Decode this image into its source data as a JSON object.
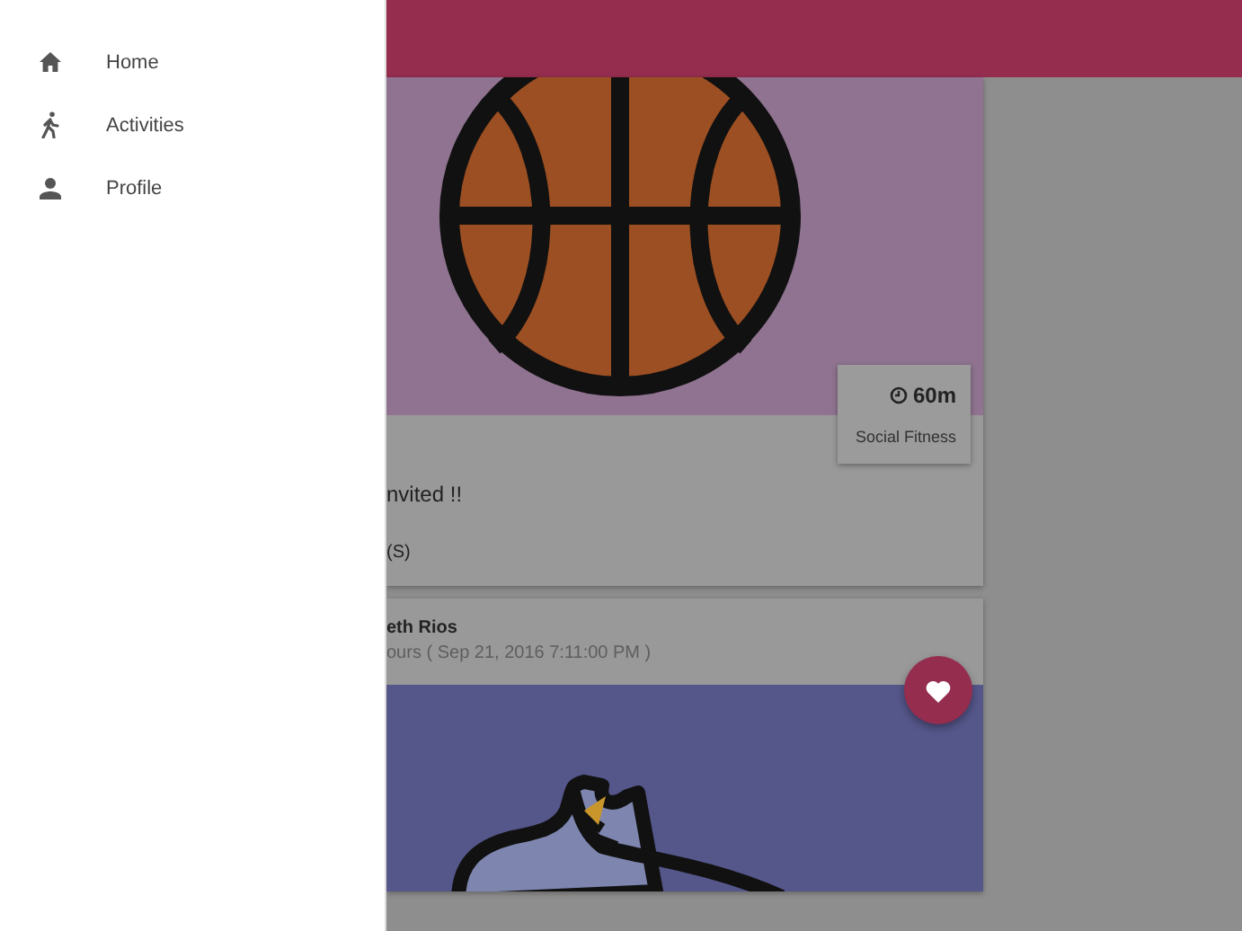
{
  "drawer": {
    "items": [
      {
        "label": "Home"
      },
      {
        "label": "Activities"
      },
      {
        "label": "Profile"
      }
    ]
  },
  "cards": [
    {
      "kind": "activity",
      "line_1": "nvited !!",
      "line_2": "(S)",
      "duration": "60m",
      "category": "Social Fitness"
    },
    {
      "kind": "post",
      "author": "eth Rios",
      "time": "ours ( Sep 21, 2016 7:11:00 PM )"
    }
  ]
}
